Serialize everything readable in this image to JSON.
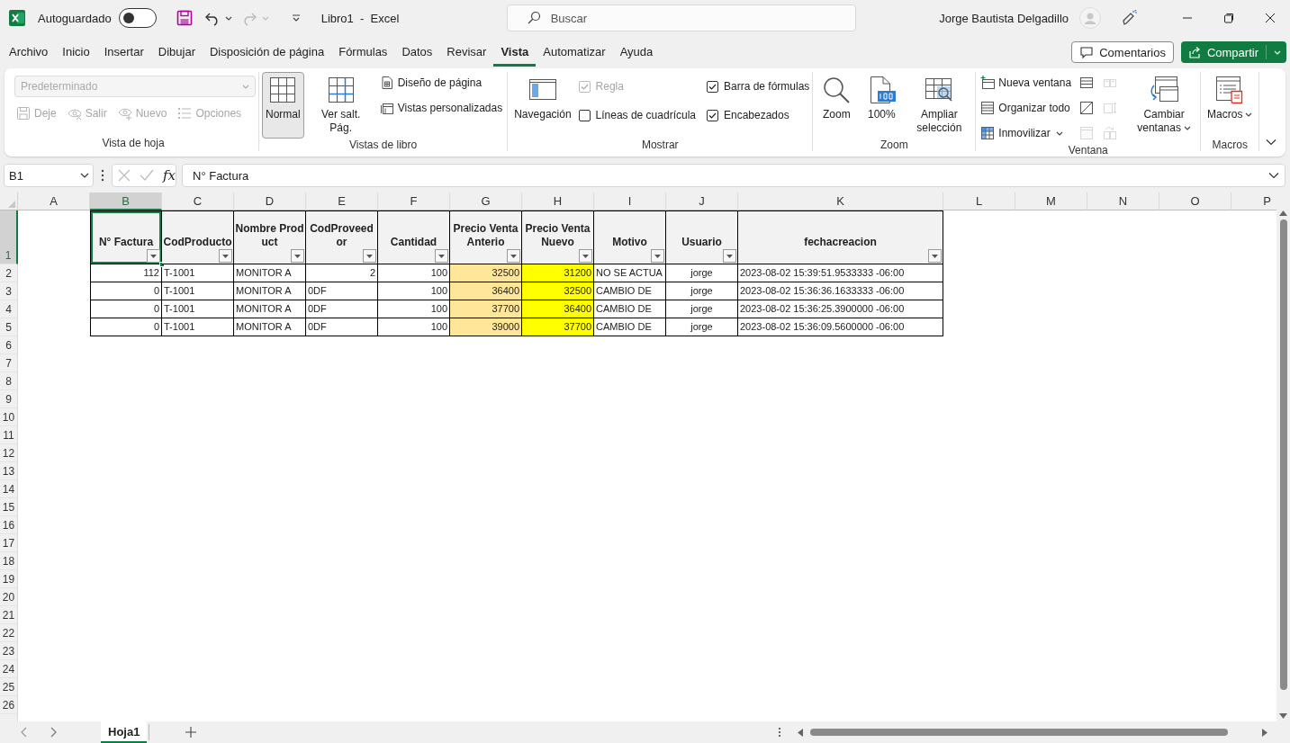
{
  "title_bar": {
    "autosave_label": "Autoguardado",
    "autosave_on": false,
    "document_title": "Libro1  -  Excel",
    "search_placeholder": "Buscar",
    "user_name": "Jorge Bautista Delgadillo"
  },
  "menu_tabs": [
    {
      "label": "Archivo",
      "selected": false
    },
    {
      "label": "Inicio",
      "selected": false
    },
    {
      "label": "Insertar",
      "selected": false
    },
    {
      "label": "Dibujar",
      "selected": false
    },
    {
      "label": "Disposición de página",
      "selected": false
    },
    {
      "label": "Fórmulas",
      "selected": false
    },
    {
      "label": "Datos",
      "selected": false
    },
    {
      "label": "Revisar",
      "selected": false
    },
    {
      "label": "Vista",
      "selected": true
    },
    {
      "label": "Automatizar",
      "selected": false
    },
    {
      "label": "Ayuda",
      "selected": false
    }
  ],
  "comments_button": {
    "label": "Comentarios"
  },
  "share_button": {
    "label": "Compartir"
  },
  "ribbon_groups": [
    {
      "title": "Vista de hoja",
      "columns": [
        [
          {
            "kind": "dropdown",
            "label": "Predeterminado",
            "disabled": true
          },
          {
            "kind": "row",
            "items": [
              {
                "kind": "small",
                "label": "Deje",
                "disabled": true
              },
              {
                "kind": "small",
                "label": "Salir",
                "disabled": true
              },
              {
                "kind": "small",
                "label": "Nuevo",
                "disabled": true
              },
              {
                "kind": "small",
                "label": "Opciones",
                "disabled": true
              }
            ]
          }
        ]
      ]
    },
    {
      "title": "Vistas de libro",
      "columns": [
        [
          {
            "kind": "large",
            "label": "Normal",
            "selected": true
          }
        ],
        [
          {
            "kind": "large",
            "label": "Ver salt. Pág.",
            "selected": false
          }
        ],
        [
          {
            "kind": "small",
            "label": "Diseño de página",
            "selected": false
          },
          {
            "kind": "small",
            "label": "Vistas personalizadas"
          }
        ]
      ]
    },
    {
      "title": "Mostrar",
      "columns": [
        [
          {
            "kind": "large",
            "label": "Navegación"
          }
        ],
        [
          {
            "kind": "check",
            "label": "Regla",
            "checked": true,
            "disabled": true
          },
          {
            "kind": "check",
            "label": "Líneas de cuadrícula",
            "checked": false,
            "disabled": false
          }
        ],
        [
          {
            "kind": "check",
            "label": "Barra de fórmulas",
            "checked": true,
            "disabled": false
          },
          {
            "kind": "check",
            "label": "Encabezados",
            "checked": true,
            "disabled": false
          }
        ]
      ]
    },
    {
      "title": "Zoom",
      "columns": [
        [
          {
            "kind": "large",
            "label": "Zoom"
          }
        ],
        [
          {
            "kind": "large",
            "label": "100%"
          }
        ],
        [
          {
            "kind": "large",
            "label": "Ampliar selección"
          }
        ]
      ]
    },
    {
      "title": "Ventana",
      "columns": [
        [
          {
            "kind": "small",
            "label": "Nueva ventana"
          },
          {
            "kind": "small",
            "label": "Organizar todo"
          },
          {
            "kind": "small",
            "label": "Inmovilizar",
            "has_menu": true
          }
        ],
        [
          {
            "kind": "icon",
            "disabled": false
          },
          {
            "kind": "icon",
            "disabled": false
          },
          {
            "kind": "icon",
            "disabled": true
          }
        ],
        [
          {
            "kind": "icon",
            "disabled": true
          },
          {
            "kind": "icon",
            "disabled": true
          },
          {
            "kind": "icon",
            "disabled": true
          }
        ],
        [
          {
            "kind": "large",
            "label": "Cambiar ventanas",
            "has_menu": true
          }
        ]
      ]
    },
    {
      "title": "Macros",
      "columns": [
        [
          {
            "kind": "large",
            "label": "Macros",
            "has_menu": true
          }
        ]
      ]
    }
  ],
  "formula_bar": {
    "name_box": "B1",
    "function_label": "fx",
    "formula": "N° Factura"
  },
  "sheet": {
    "columns": [
      {
        "label": "A",
        "selected": false
      },
      {
        "label": "B",
        "selected": true
      },
      {
        "label": "C",
        "selected": false
      },
      {
        "label": "D",
        "selected": false
      },
      {
        "label": "E",
        "selected": false
      },
      {
        "label": "F",
        "selected": false
      },
      {
        "label": "G",
        "selected": false
      },
      {
        "label": "H",
        "selected": false
      },
      {
        "label": "I",
        "selected": false
      },
      {
        "label": "J",
        "selected": false
      },
      {
        "label": "K",
        "selected": false
      },
      {
        "label": "L",
        "selected": false
      },
      {
        "label": "M",
        "selected": false
      },
      {
        "label": "N",
        "selected": false
      },
      {
        "label": "O",
        "selected": false
      },
      {
        "label": "P",
        "selected": false
      }
    ],
    "rows": [
      {
        "label": "1",
        "selected": true
      },
      {
        "label": "2",
        "selected": false
      },
      {
        "label": "3",
        "selected": false
      },
      {
        "label": "4",
        "selected": false
      },
      {
        "label": "5",
        "selected": false
      },
      {
        "label": "6",
        "selected": false
      },
      {
        "label": "7",
        "selected": false
      },
      {
        "label": "8",
        "selected": false
      },
      {
        "label": "9",
        "selected": false
      },
      {
        "label": "10",
        "selected": false
      },
      {
        "label": "11",
        "selected": false
      },
      {
        "label": "12",
        "selected": false
      },
      {
        "label": "13",
        "selected": false
      },
      {
        "label": "14",
        "selected": false
      },
      {
        "label": "15",
        "selected": false
      },
      {
        "label": "16",
        "selected": false
      },
      {
        "label": "17",
        "selected": false
      },
      {
        "label": "18",
        "selected": false
      },
      {
        "label": "19",
        "selected": false
      },
      {
        "label": "20",
        "selected": false
      },
      {
        "label": "21",
        "selected": false
      },
      {
        "label": "22",
        "selected": false
      },
      {
        "label": "23",
        "selected": false
      },
      {
        "label": "24",
        "selected": false
      },
      {
        "label": "25",
        "selected": false
      },
      {
        "label": "26",
        "selected": false
      }
    ]
  },
  "table": {
    "columns": [
      {
        "header": "N° Factura",
        "kind": "number",
        "selected": true
      },
      {
        "header": "CodProducto",
        "kind": "text",
        "selected": false
      },
      {
        "header": "Nombre Product",
        "kind": "text",
        "selected": false
      },
      {
        "header": "CodProveedor",
        "selected": false
      },
      {
        "header": "Cantidad",
        "kind": "number",
        "selected": false
      },
      {
        "header": "Precio Venta Anterio",
        "kind": "number",
        "selected": false,
        "color": "#ffe699"
      },
      {
        "header": "Precio Venta Nuevo",
        "kind": "number",
        "selected": false,
        "color": "#ffff00"
      },
      {
        "header": "Motivo",
        "kind": "text",
        "selected": false
      },
      {
        "header": "Usuario",
        "kind": "center",
        "selected": false
      },
      {
        "header": "fechacreacion",
        "kind": "text",
        "selected": false
      }
    ],
    "rows": [
      [
        "112",
        "T-1001",
        "MONITOR A",
        {
          "text": "2",
          "kind": "number"
        },
        "100",
        "32500",
        "31200",
        "NO SE ACTUA",
        "jorge",
        "2023-08-02 15:39:51.9533333 -06:00"
      ],
      [
        "0",
        "T-1001",
        "MONITOR A",
        {
          "text": "0DF",
          "kind": "text"
        },
        "100",
        "36400",
        "32500",
        "CAMBIO DE",
        "jorge",
        "2023-08-02 15:36:36.1633333 -06:00"
      ],
      [
        "0",
        "T-1001",
        "MONITOR A",
        {
          "text": "0DF",
          "kind": "text"
        },
        "100",
        "37700",
        "36400",
        "CAMBIO DE",
        "jorge",
        "2023-08-02 15:36:25.3900000 -06:00"
      ],
      [
        "0",
        "T-1001",
        "MONITOR A",
        {
          "text": "0DF",
          "kind": "text"
        },
        "100",
        "39000",
        "37700",
        "CAMBIO DE",
        "jorge",
        "2023-08-02 15:36:09.5600000 -06:00"
      ]
    ]
  },
  "sheet_tabs": [
    {
      "label": "Hoja1",
      "selected": true
    }
  ]
}
